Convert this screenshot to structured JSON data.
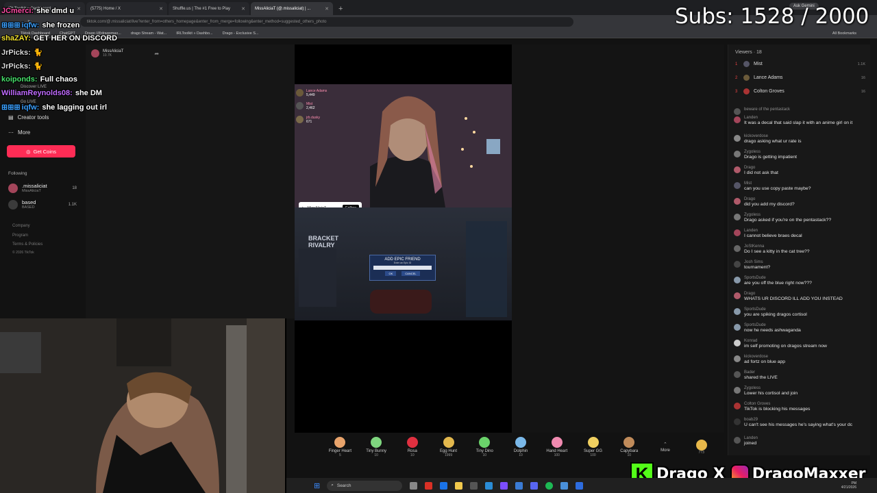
{
  "browser": {
    "tabs": [
      {
        "label": "IRLToolkit » Dashboard"
      },
      {
        "label": "(5775) Home / X"
      },
      {
        "label": "Shuffle.us | The #1 Free to Play"
      },
      {
        "label": "MissAliciaT (@.missaliciat) | ..."
      }
    ],
    "new_tab": "+",
    "url": "tiktok.com/@.missaliciat/live?enter_from=others_homepage&enter_from_merge=following&enter_method=suggested_others_photo",
    "bookmarks": [
      "Tiktok Dashboard",
      "ChatGPT",
      "Drago (@dragomax...",
      "drago Stream - Wat...",
      "IRLToolkit » Dashbo...",
      "Drago - Exclusive S..."
    ],
    "all_bookmarks": "All Bookmarks",
    "ask_gemini": "Ask Gemini"
  },
  "overlay": {
    "subs": "Subs: 1528 / 2000",
    "chat": [
      {
        "user": "JCmerci:",
        "msg": "she dmd u",
        "color": "#ff4da6"
      },
      {
        "user": "iqfw:",
        "msg": "she frozen",
        "color": "#3aa0ff"
      },
      {
        "user": "shaZAY:",
        "msg": "GET HER ON DISCORD",
        "color": "#f0e030"
      },
      {
        "user": "JrPicks:",
        "msg": "",
        "color": "#d9d9d9"
      },
      {
        "user": "JrPicks:",
        "msg": "",
        "color": "#d9d9d9"
      },
      {
        "user": "koiponds:",
        "msg": "Full chaos",
        "color": "#48e06b"
      },
      {
        "user": "WilliamReynolds08:",
        "msg": "she DM",
        "color": "#c06bff"
      },
      {
        "user": "iqfw:",
        "msg": "she lagging out irl",
        "color": "#3aa0ff"
      }
    ],
    "socials": {
      "kick": "Drago",
      "x": "X",
      "instagram": "DragoMaxxer"
    }
  },
  "sidebar": {
    "discover": "Discover LIVE",
    "go_live": "Go LIVE",
    "creator_tools": "Creator tools",
    "more": "More",
    "get_coins": "Get Coins",
    "following_label": "Following",
    "following": [
      {
        "name": ".missaliciat",
        "sub": "MissAliciaT",
        "count": "18"
      },
      {
        "name": "based",
        "sub": "BASED",
        "count": "1.1K"
      }
    ],
    "footer": [
      "Company",
      "Program",
      "Terms & Policies",
      "© 2026 TikTok"
    ]
  },
  "stream": {
    "host_name": "MissAliciaT",
    "host_viewers": "10.7K",
    "top_gifters": [
      {
        "name": "Lance Adams",
        "score": "5,449"
      },
      {
        "name": "Mist",
        "score": "2,462"
      },
      {
        "name": "jrb.dusky",
        "score": "671"
      }
    ],
    "tag_name": ".MissAliciaT",
    "follow_label": "Follow",
    "game_dialog_title": "ADD EPIC FRIEND",
    "game_dialog_sub": "Enter an Epic ID",
    "game_ok": "OK",
    "game_cancel": "CANCEL",
    "game_logo": "BRACKET RIVALRY"
  },
  "gifts": [
    {
      "name": "Finger Heart",
      "price": "5",
      "color": "#e8a36b"
    },
    {
      "name": "Tiny Bunny",
      "price": "10",
      "color": "#7fd67f"
    },
    {
      "name": "Rosa",
      "price": "10",
      "color": "#e03040"
    },
    {
      "name": "Egg Hunt",
      "price": "1999",
      "color": "#e3b84d"
    },
    {
      "name": "Tiny Dino",
      "price": "10",
      "color": "#6ad36a"
    },
    {
      "name": "Dolphin",
      "price": "10",
      "color": "#7ab8e8"
    },
    {
      "name": "Hand Heart",
      "price": "100",
      "color": "#f08ab0"
    },
    {
      "name": "Super GG",
      "price": "100",
      "color": "#f0d060"
    },
    {
      "name": "Capybara",
      "price": "10",
      "color": "#c08b5a"
    }
  ],
  "gift_more": "More",
  "coins": "773",
  "chatpanel": {
    "viewers_label": "Viewers · 18",
    "viewers": [
      {
        "rank": "1",
        "name": "Mist",
        "num": "1.1K"
      },
      {
        "rank": "2",
        "name": "Lance Adams",
        "num": "16"
      },
      {
        "rank": "3",
        "name": "Colton Groves",
        "num": "16"
      }
    ],
    "messages": [
      {
        "user": "beware of the pentastack",
        "text": "",
        "color": "#555"
      },
      {
        "user": "Landen",
        "text": "It was a decal that said slap it with an anime girl on it",
        "color": "#a3455a"
      },
      {
        "user": "kickoverdose",
        "text": "drago asking what ur rate is",
        "color": "#888"
      },
      {
        "user": "Zygoless",
        "text": "Drago is getting impatient",
        "color": "#777"
      },
      {
        "user": "Drago",
        "text": "I did not ask that",
        "color": "#b05a6a"
      },
      {
        "user": "Mist",
        "text": "can you use copy paste maybe?",
        "color": "#556"
      },
      {
        "user": "Drago",
        "text": "did you add my discord?",
        "color": "#b05a6a"
      },
      {
        "user": "Zygoless",
        "text": "Drago asked if you're on the pentastack??",
        "color": "#777"
      },
      {
        "user": "Landen",
        "text": "I cannot believe braes decal",
        "color": "#a3455a"
      },
      {
        "user": "JoStKenna",
        "text": "Do I see a kitty in the cat tree??",
        "color": "#666"
      },
      {
        "user": "Josh Sims",
        "text": "tournament?",
        "color": "#444"
      },
      {
        "user": "SportsDude",
        "text": "are you off the blue right now???",
        "color": "#89a"
      },
      {
        "user": "Drago",
        "text": "WHATS UR DISCORD ILL ADD YOU INSTEAD",
        "color": "#b05a6a"
      },
      {
        "user": "SportsDude",
        "text": "you are spiking dragos cortisol",
        "color": "#89a"
      },
      {
        "user": "SportsDude",
        "text": "now he needs ashwaganda",
        "color": "#89a"
      },
      {
        "user": "Konrad",
        "text": "im self promoting on dragos stream now",
        "color": "#ccc"
      },
      {
        "user": "kickoverdose",
        "text": "ad fortz on blue app",
        "color": "#888"
      },
      {
        "user": "Bader",
        "text": "shared the LIVE",
        "color": "#555"
      },
      {
        "user": "Zygoless",
        "text": "Lower his cortisol and join",
        "color": "#777"
      },
      {
        "user": "Colton Groves",
        "text": "TikTok is blocking his messages",
        "color": "#a33"
      },
      {
        "user": "boab29",
        "text": "U can't see his messages he's saying what's your dc",
        "color": "#333"
      },
      {
        "user": "Landen",
        "text": "joined",
        "color": "#555"
      }
    ]
  },
  "taskbar": {
    "search": "Search",
    "time": "PM",
    "date": "4/21/2026"
  }
}
